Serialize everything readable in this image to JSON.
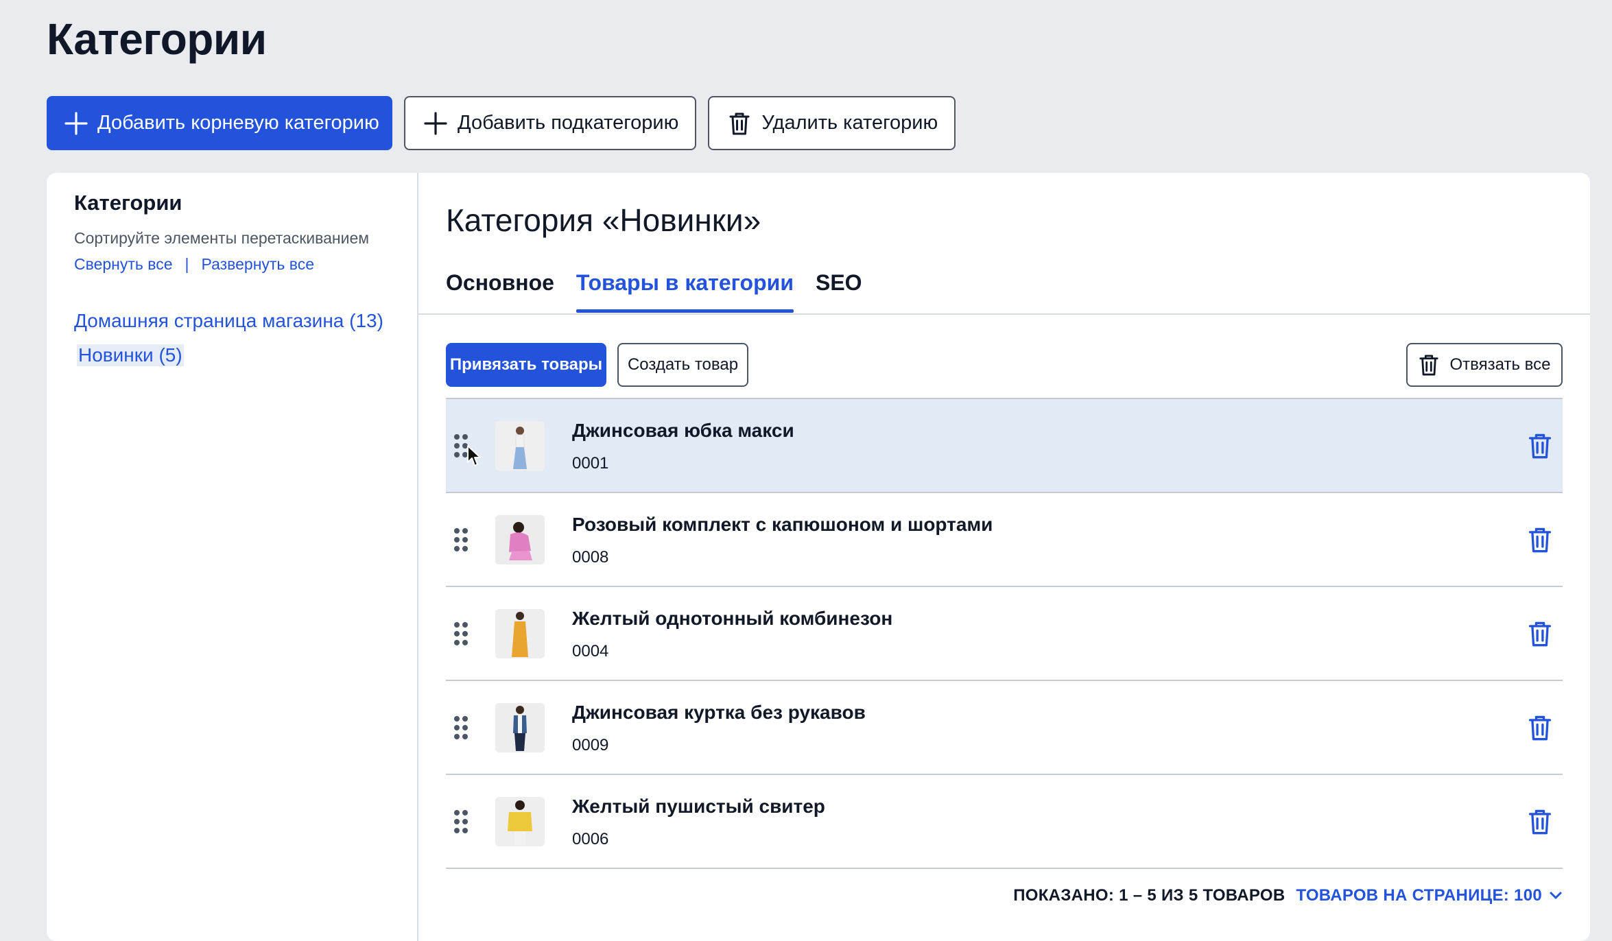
{
  "page": {
    "title": "Категории"
  },
  "toolbar": {
    "add_root_label": "Добавить корневую категорию",
    "add_sub_label": "Добавить подкатегорию",
    "delete_label": "Удалить категорию"
  },
  "sidebar": {
    "title": "Категории",
    "hint": "Сортируйте элементы перетаскиванием",
    "collapse_all": "Свернуть все",
    "separator": "|",
    "expand_all": "Развернуть все",
    "items": [
      {
        "label": "Домашняя страница магазина (13)"
      },
      {
        "label": "Новинки (5)",
        "selected": true
      }
    ]
  },
  "main": {
    "category_title": "Категория «Новинки»",
    "tabs": [
      {
        "label": "Основное"
      },
      {
        "label": "Товары в категории",
        "active": true
      },
      {
        "label": "SEO"
      }
    ],
    "actions": {
      "attach_label": "Привязать товары",
      "create_label": "Создать товар",
      "detach_all_label": "Отвязать все"
    },
    "products": [
      {
        "name": "Джинсовая юбка макси",
        "sku": "0001",
        "thumb_color": "#8fb2dc"
      },
      {
        "name": "Розовый комплект с капюшоном и шортами",
        "sku": "0008",
        "thumb_color": "#e07fc1"
      },
      {
        "name": "Желтый однотонный комбинезон",
        "sku": "0004",
        "thumb_color": "#e8a630"
      },
      {
        "name": "Джинсовая куртка без рукавов",
        "sku": "0009",
        "thumb_color": "#3a5d8f"
      },
      {
        "name": "Желтый пушистый свитер",
        "sku": "0006",
        "thumb_color": "#ecc93a"
      }
    ],
    "footer": {
      "shown": "ПОКАЗАНО: 1 – 5 ИЗ 5 ТОВАРОВ",
      "per_page": "ТОВАРОВ НА СТРАНИЦЕ: 100"
    }
  },
  "colors": {
    "accent": "#2453db",
    "highlight_row": "#e2eaf6",
    "background": "#e9ebef"
  },
  "icons": [
    "plus-icon",
    "trash-icon",
    "drag-handle-icon",
    "chevron-down-icon",
    "mouse-cursor-icon"
  ]
}
